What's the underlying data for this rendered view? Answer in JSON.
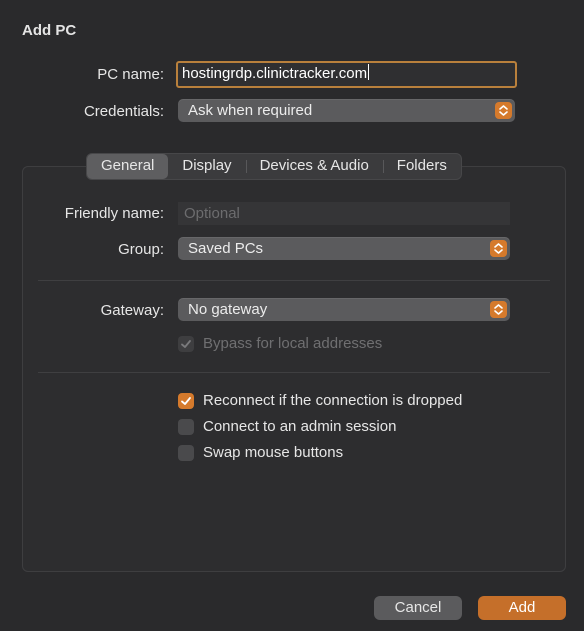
{
  "dialog": {
    "title": "Add PC"
  },
  "pc_name": {
    "label": "PC name:",
    "value": "hostingrdp.clinictracker.com"
  },
  "credentials": {
    "label": "Credentials:",
    "value": "Ask when required"
  },
  "tabs": [
    {
      "label": "General",
      "active": true
    },
    {
      "label": "Display",
      "active": false
    },
    {
      "label": "Devices & Audio",
      "active": false
    },
    {
      "label": "Folders",
      "active": false
    }
  ],
  "general": {
    "friendly_name": {
      "label": "Friendly name:",
      "value": "",
      "placeholder": "Optional"
    },
    "group": {
      "label": "Group:",
      "value": "Saved PCs"
    },
    "gateway": {
      "label": "Gateway:",
      "value": "No gateway"
    },
    "bypass_local": {
      "label": "Bypass for local addresses",
      "checked": true,
      "enabled": false
    },
    "reconnect": {
      "label": "Reconnect if the connection is dropped",
      "checked": true
    },
    "admin_session": {
      "label": "Connect to an admin session",
      "checked": false
    },
    "swap_mouse": {
      "label": "Swap mouse buttons",
      "checked": false
    }
  },
  "buttons": {
    "cancel": "Cancel",
    "add": "Add"
  },
  "colors": {
    "accent": "#d57a2c",
    "background": "#2a2a2c",
    "focus_ring": "#b9803c"
  }
}
